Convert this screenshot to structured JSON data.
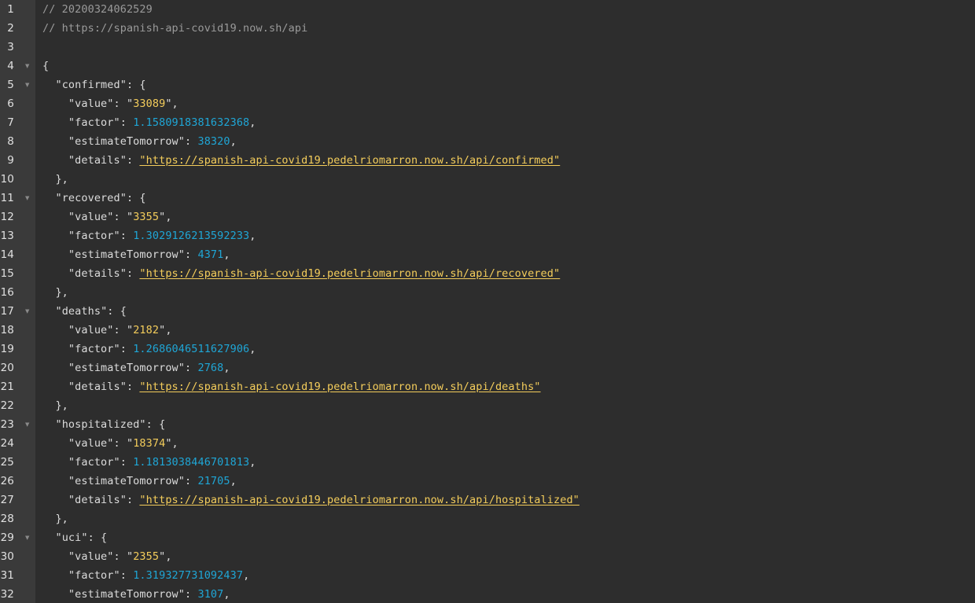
{
  "colors": {
    "background": "#2d2d2d",
    "gutter": "#3a3a3a",
    "comment": "#9a9a9a",
    "string": "#f4cd5b",
    "number": "#1fa6d6",
    "text": "#dcdcdc"
  },
  "icons": {
    "fold": "fold-triangle-icon"
  },
  "header": {
    "timestamp_comment": "// 20200324062529",
    "url_comment": "// https://spanish-api-covid19.now.sh/api"
  },
  "sections": [
    {
      "key": "confirmed",
      "value": "33089",
      "factor": "1.1580918381632368",
      "estimateTomorrow": "38320",
      "details": "https://spanish-api-covid19.pedelriomarron.now.sh/api/confirmed"
    },
    {
      "key": "recovered",
      "value": "3355",
      "factor": "1.3029126213592233",
      "estimateTomorrow": "4371",
      "details": "https://spanish-api-covid19.pedelriomarron.now.sh/api/recovered"
    },
    {
      "key": "deaths",
      "value": "2182",
      "factor": "1.2686046511627906",
      "estimateTomorrow": "2768",
      "details": "https://spanish-api-covid19.pedelriomarron.now.sh/api/deaths"
    },
    {
      "key": "hospitalized",
      "value": "18374",
      "factor": "1.1813038446701813",
      "estimateTomorrow": "21705",
      "details": "https://spanish-api-covid19.pedelriomarron.now.sh/api/hospitalized"
    },
    {
      "key": "uci",
      "value": "2355",
      "factor": "1.319327731092437",
      "estimateTomorrow": "3107"
    }
  ]
}
